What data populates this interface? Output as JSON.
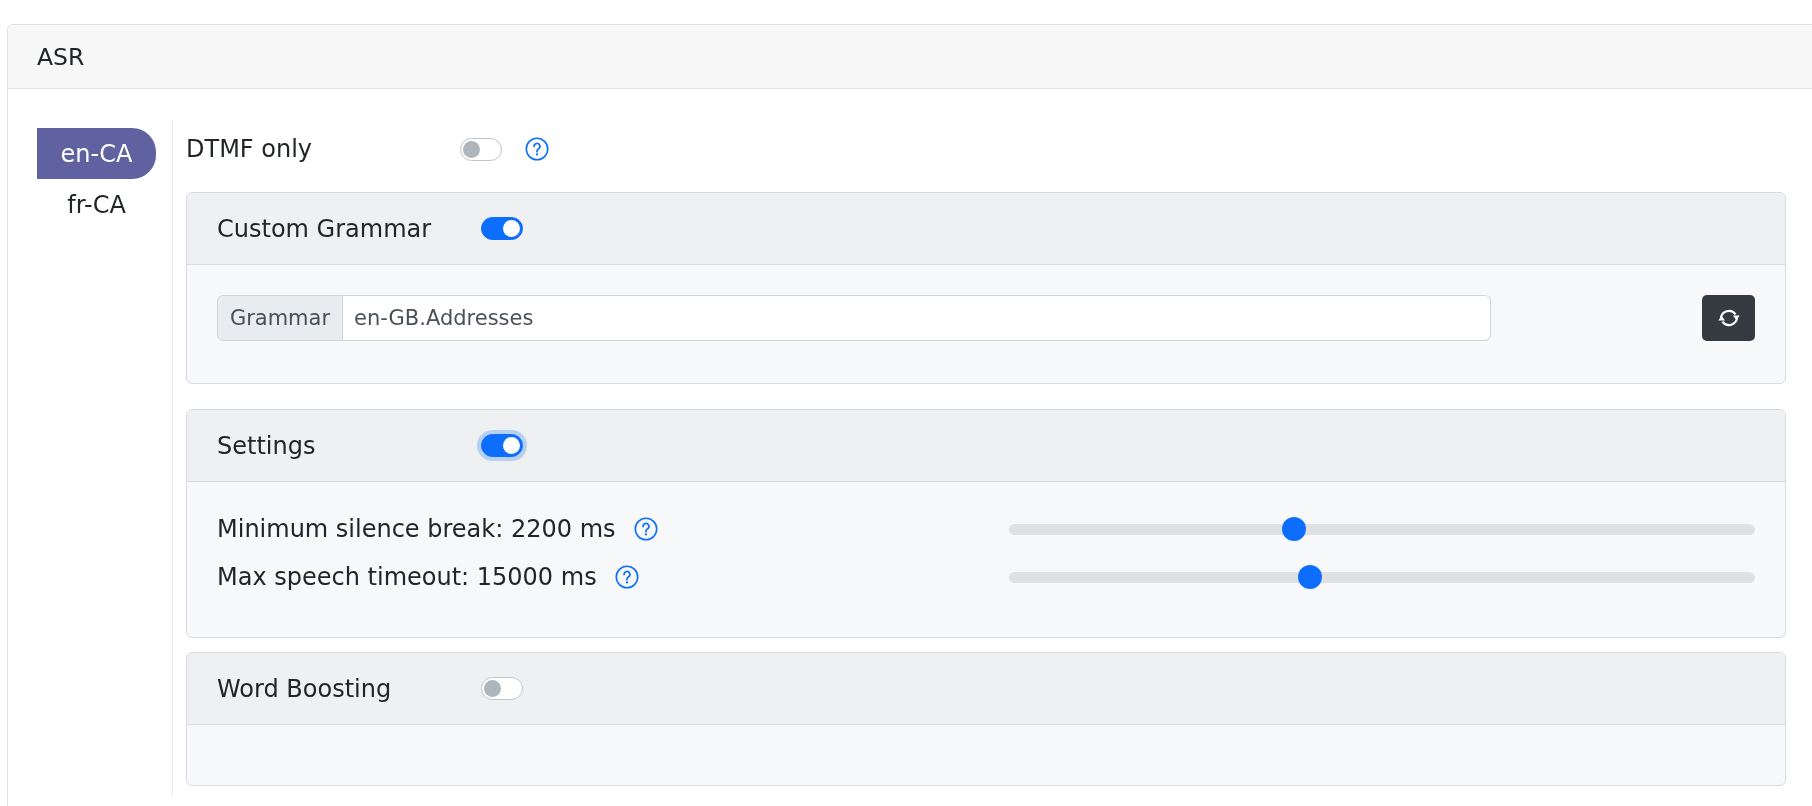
{
  "panel": {
    "title": "ASR"
  },
  "languages": [
    {
      "label": "en-CA",
      "selected": true
    },
    {
      "label": "fr-CA",
      "selected": false
    }
  ],
  "dtmf_only": {
    "label": "DTMF only",
    "on": false
  },
  "sections": [
    {
      "kind": "grammar",
      "title": "Custom Grammar",
      "on": true,
      "focused": false,
      "grammar": {
        "label": "Grammar",
        "value": "en-GB.Addresses"
      }
    },
    {
      "kind": "sliders",
      "title": "Settings",
      "on": true,
      "focused": true,
      "settings": [
        {
          "label": "Minimum silence break: 2200 ms",
          "level": 0.378
        },
        {
          "label": "Max speech timeout: 15000 ms",
          "level": 0.4
        }
      ]
    },
    {
      "kind": "empty",
      "title": "Word Boosting",
      "on": false,
      "focused": false
    }
  ]
}
